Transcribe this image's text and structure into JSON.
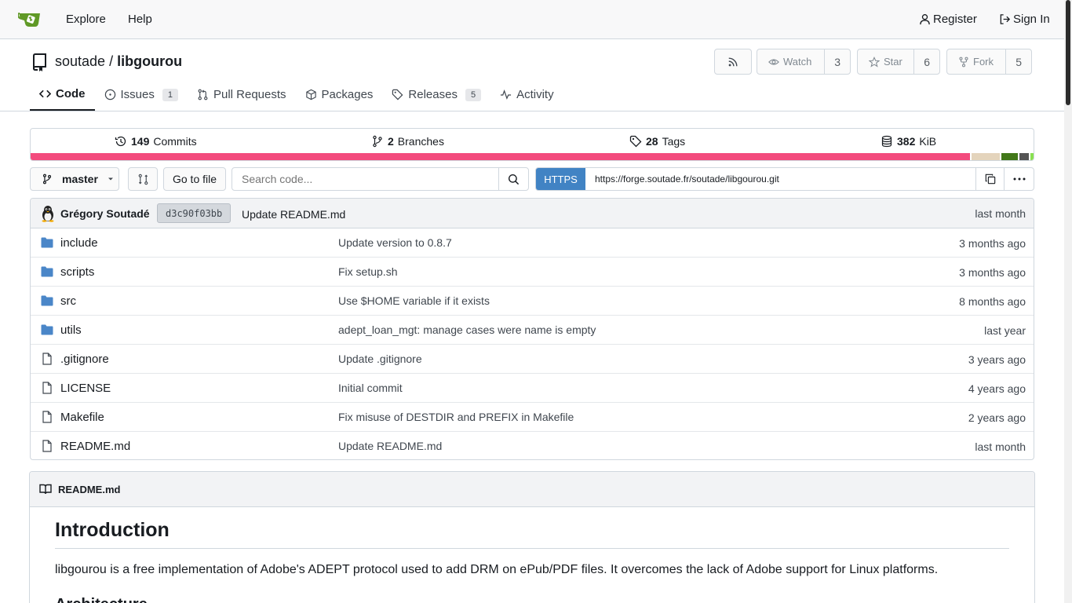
{
  "nav": {
    "explore": "Explore",
    "help": "Help",
    "register": "Register",
    "sign_in": "Sign In"
  },
  "repo": {
    "owner": "soutade",
    "separator": "/",
    "name": "libgourou",
    "watch_label": "Watch",
    "watch_count": "3",
    "star_label": "Star",
    "star_count": "6",
    "fork_label": "Fork",
    "fork_count": "5"
  },
  "tabs": {
    "code": "Code",
    "issues": "Issues",
    "issues_count": "1",
    "pull_requests": "Pull Requests",
    "packages": "Packages",
    "releases": "Releases",
    "releases_count": "5",
    "activity": "Activity"
  },
  "stats": {
    "commits_count": "149",
    "commits_label": "Commits",
    "branches_count": "2",
    "branches_label": "Branches",
    "tags_count": "28",
    "tags_label": "Tags",
    "size_count": "382",
    "size_label": "KiB"
  },
  "language_bar": [
    {
      "color": "#f34b7d",
      "percent": 93.7
    },
    {
      "color": "#e4d4bc",
      "percent": 2.9
    },
    {
      "color": "#427819",
      "percent": 1.8
    },
    {
      "color": "#555555",
      "percent": 1.1
    },
    {
      "color": "#89e051",
      "percent": 0.5
    }
  ],
  "toolbar": {
    "branch": "master",
    "go_to_file": "Go to file",
    "search_placeholder": "Search code...",
    "https_label": "HTTPS",
    "clone_url": "https://forge.soutade.fr/soutade/libgourou.git"
  },
  "latest_commit": {
    "author": "Grégory Soutadé",
    "sha": "d3c90f03bb",
    "message": "Update README.md",
    "time": "last month"
  },
  "files": [
    {
      "type": "dir",
      "name": "include",
      "message": "Update version to 0.8.7",
      "time": "3 months ago"
    },
    {
      "type": "dir",
      "name": "scripts",
      "message": "Fix setup.sh",
      "time": "3 months ago"
    },
    {
      "type": "dir",
      "name": "src",
      "message": "Use $HOME variable if it exists",
      "time": "8 months ago"
    },
    {
      "type": "dir",
      "name": "utils",
      "message": "adept_loan_mgt: manage cases were name is empty",
      "time": "last year"
    },
    {
      "type": "file",
      "name": ".gitignore",
      "message": "Update .gitignore",
      "time": "3 years ago"
    },
    {
      "type": "file",
      "name": "LICENSE",
      "message": "Initial commit",
      "time": "4 years ago"
    },
    {
      "type": "file",
      "name": "Makefile",
      "message": "Fix misuse of DESTDIR and PREFIX in Makefile",
      "time": "2 years ago"
    },
    {
      "type": "file",
      "name": "README.md",
      "message": "Update README.md",
      "time": "last month"
    }
  ],
  "readme": {
    "filename": "README.md",
    "heading": "Introduction",
    "paragraph": "libgourou is a free implementation of Adobe's ADEPT protocol used to add DRM on ePub/PDF files. It overcomes the lack of Adobe support for Linux platforms.",
    "next_heading": "Architecture"
  },
  "colors": {
    "accent": "#4183c4",
    "folder": "#4a86c8",
    "logo": "#609926"
  }
}
